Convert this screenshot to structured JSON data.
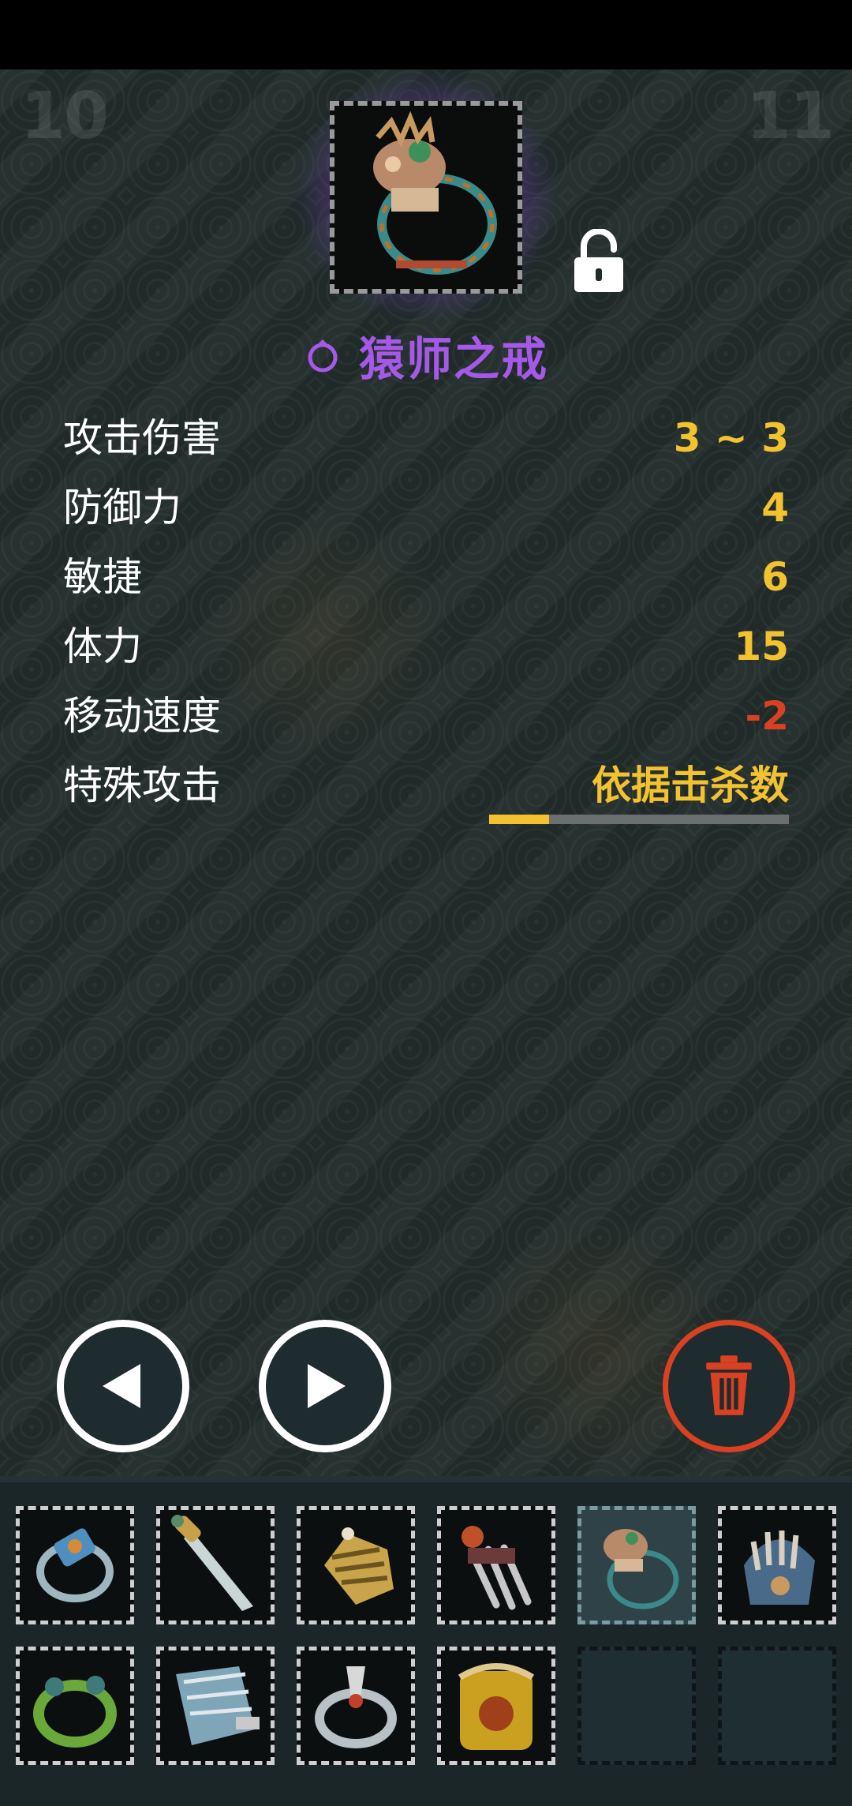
{
  "corner": {
    "left_number": "10",
    "right_number": "11"
  },
  "item": {
    "name": "猿师之戒",
    "rarity_color": "#a659e8",
    "icon": "monkey-ring-icon",
    "type_icon": "ring-icon",
    "lock_state": "unlocked",
    "lock_icon": "unlock-icon"
  },
  "stats": [
    {
      "label": "攻击伤害",
      "value": "3 ~ 3",
      "color": "#f2c230"
    },
    {
      "label": "防御力",
      "value": "4",
      "color": "#f2c230"
    },
    {
      "label": "敏捷",
      "value": "6",
      "color": "#f2c230"
    },
    {
      "label": "体力",
      "value": "15",
      "color": "#f2c230"
    },
    {
      "label": "移动速度",
      "value": "-2",
      "color": "#d94122"
    },
    {
      "label": "特殊攻击",
      "value": "依据击杀数",
      "color": "#f2c230"
    }
  ],
  "special_attack_progress": 0.2,
  "controls": {
    "prev_icon": "left-triangle-icon",
    "next_icon": "right-triangle-icon",
    "delete_icon": "trash-icon",
    "delete_color": "#d94122"
  },
  "inventory": {
    "slots": [
      {
        "icon": "blue-ring-icon",
        "state": "filled"
      },
      {
        "icon": "dagger-icon",
        "state": "filled"
      },
      {
        "icon": "gold-gauntlet-icon",
        "state": "filled"
      },
      {
        "icon": "claw-gauntlet-icon",
        "state": "filled"
      },
      {
        "icon": "monkey-ring-icon",
        "state": "selected"
      },
      {
        "icon": "ape-helmet-icon",
        "state": "filled"
      },
      {
        "icon": "jade-ring-icon",
        "state": "filled"
      },
      {
        "icon": "fan-blade-icon",
        "state": "filled"
      },
      {
        "icon": "silver-ring-icon",
        "state": "filled"
      },
      {
        "icon": "gold-amulet-icon",
        "state": "filled"
      },
      {
        "icon": "empty-slot",
        "state": "empty"
      },
      {
        "icon": "empty-slot",
        "state": "empty"
      }
    ]
  }
}
